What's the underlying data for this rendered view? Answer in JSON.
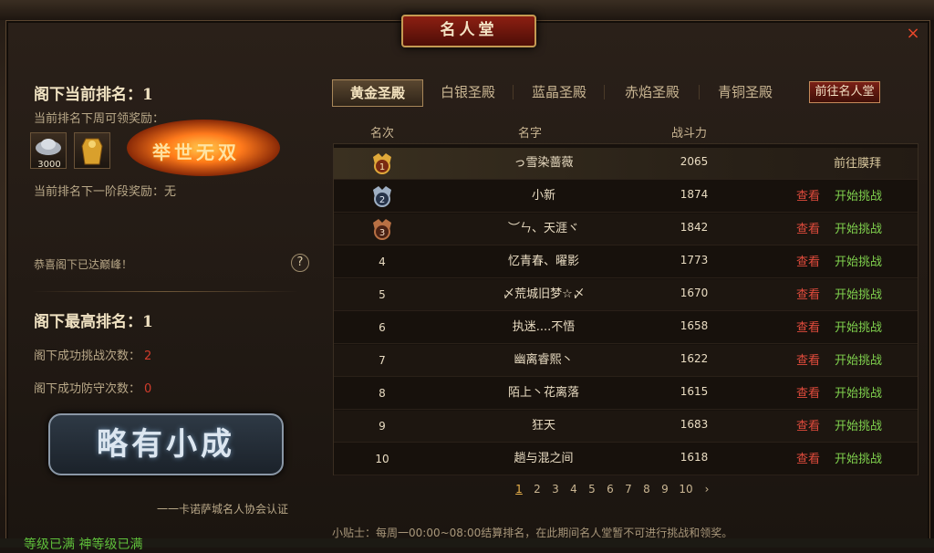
{
  "window": {
    "title": "名人堂",
    "close_icon": "×"
  },
  "left": {
    "current_rank_label": "阁下当前排名：1",
    "weekly_reward_label": "当前排名下周可领奖励：",
    "reward_items": [
      {
        "icon": "silver-ingot-icon",
        "count": "3000"
      },
      {
        "icon": "golden-armor-icon",
        "count": ""
      }
    ],
    "reward_title": "举世无双",
    "next_tier_label": "当前排名下一阶段奖励：无",
    "peak_message": "恭喜阁下已达巅峰！",
    "help_glyph": "?",
    "best_rank_label": "阁下最高排名：1",
    "stats": [
      {
        "label": "阁下成功挑战次数：",
        "value": "2"
      },
      {
        "label": "阁下成功防守次数：",
        "value": "0"
      }
    ],
    "title_badge": "略有小成",
    "certification": "一一卡诺萨城名人协会认证"
  },
  "tabs": [
    {
      "label": "黄金圣殿",
      "active": true
    },
    {
      "label": "白银圣殿",
      "active": false
    },
    {
      "label": "蓝晶圣殿",
      "active": false
    },
    {
      "label": "赤焰圣殿",
      "active": false
    },
    {
      "label": "青铜圣殿",
      "active": false
    }
  ],
  "goto_button": "前往名人堂",
  "table": {
    "headers": {
      "rank": "名次",
      "name": "名字",
      "power": "战斗力"
    },
    "view_label": "查看",
    "challenge_label": "开始挑战",
    "worship_label": "前往膜拜",
    "rows": [
      {
        "rank": "1",
        "name": "っ雪染蔷薇",
        "power": "2065"
      },
      {
        "rank": "2",
        "name": "小新",
        "power": "1874"
      },
      {
        "rank": "3",
        "name": "︶ㄣ、天涯ヾ",
        "power": "1842"
      },
      {
        "rank": "4",
        "name": "忆青春、曜影",
        "power": "1773"
      },
      {
        "rank": "5",
        "name": "〆荒城旧梦☆〆",
        "power": "1670"
      },
      {
        "rank": "6",
        "name": "执迷....不悟",
        "power": "1658"
      },
      {
        "rank": "7",
        "name": "幽离睿熙丶",
        "power": "1622"
      },
      {
        "rank": "8",
        "name": "陌上丶花离落",
        "power": "1615"
      },
      {
        "rank": "9",
        "name": "狂天",
        "power": "1683"
      },
      {
        "rank": "10",
        "name": "趟与混之间",
        "power": "1618"
      }
    ]
  },
  "pager": {
    "pages": [
      "1",
      "2",
      "3",
      "4",
      "5",
      "6",
      "7",
      "8",
      "9",
      "10"
    ],
    "current": "1",
    "next_glyph": "›"
  },
  "tip": "小贴士：每周一00:00~08:00结算排名，在此期间名人堂暂不可进行挑战和领奖。",
  "bottom": "等级已满 神等级已满",
  "colors": {
    "gold_medal": "#e0a93a",
    "silver_medal": "#9fb0c4",
    "bronze_medal": "#b87044",
    "view": "#e04b3c",
    "challenge": "#7fd04d"
  }
}
